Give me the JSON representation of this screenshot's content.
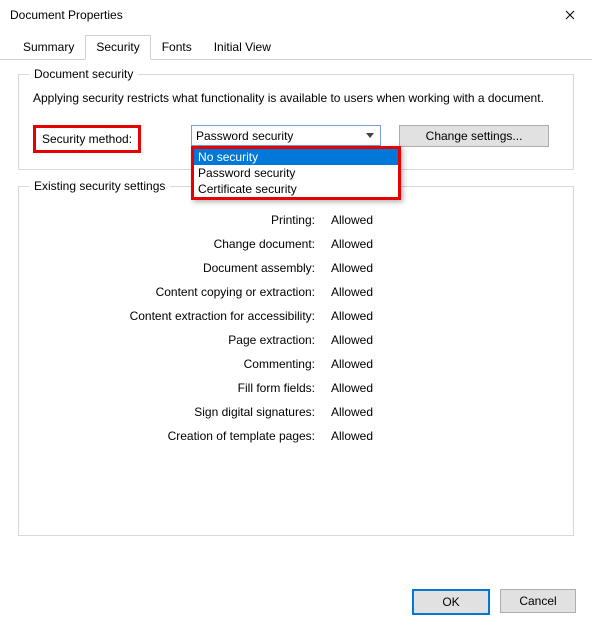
{
  "window": {
    "title": "Document Properties"
  },
  "tabs": {
    "summary": "Summary",
    "security": "Security",
    "fonts": "Fonts",
    "initial_view": "Initial View"
  },
  "doc_security": {
    "group_title": "Document security",
    "description": "Applying security restricts what functionality is available to users when working with a document.",
    "method_label": "Security method:",
    "combo_selected": "Password security",
    "options": {
      "none": "No security",
      "password": "Password security",
      "certificate": "Certificate security"
    },
    "change_btn": "Change settings..."
  },
  "existing": {
    "group_title": "Existing security settings",
    "rows": [
      {
        "k": "Printing:",
        "v": "Allowed"
      },
      {
        "k": "Change document:",
        "v": "Allowed"
      },
      {
        "k": "Document assembly:",
        "v": "Allowed"
      },
      {
        "k": "Content copying or extraction:",
        "v": "Allowed"
      },
      {
        "k": "Content extraction for accessibility:",
        "v": "Allowed"
      },
      {
        "k": "Page extraction:",
        "v": "Allowed"
      },
      {
        "k": "Commenting:",
        "v": "Allowed"
      },
      {
        "k": "Fill form fields:",
        "v": "Allowed"
      },
      {
        "k": "Sign digital signatures:",
        "v": "Allowed"
      },
      {
        "k": "Creation of template pages:",
        "v": "Allowed"
      }
    ]
  },
  "footer": {
    "ok": "OK",
    "cancel": "Cancel"
  }
}
